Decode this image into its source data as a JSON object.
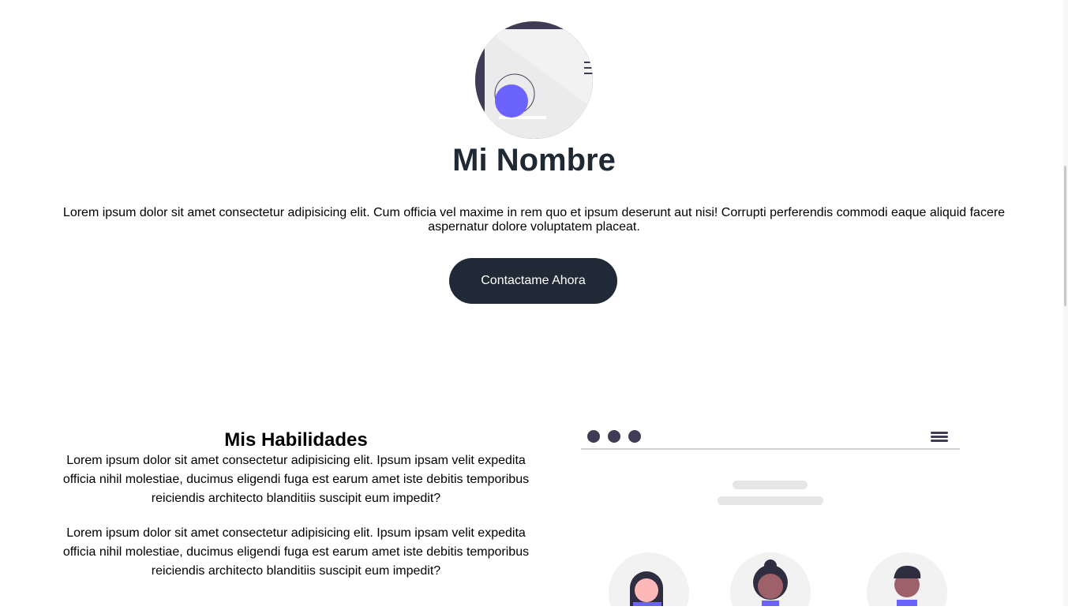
{
  "hero": {
    "name": "Mi Nombre",
    "description": "Lorem ipsum dolor sit amet consectetur adipisicing elit. Cum officia vel maxime in rem quo et ipsum deserunt aut nisi! Corrupti perferendis commodi eaque aliquid facere aspernatur dolore voluptatem placeat.",
    "cta_label": "Contactame Ahora",
    "avatar_icon": "developer-illustration-icon"
  },
  "skills": {
    "title": "Mis Habilidades",
    "paragraphs": [
      "Lorem ipsum dolor sit amet consectetur adipisicing elit. Ipsum ipsam velit expedita officia nihil molestiae, ducimus eligendi fuga est earum amet iste debitis temporibus reiciendis architecto blanditiis suscipit eum impedit?",
      "Lorem ipsum dolor sit amet consectetur adipisicing elit. Ipsum ipsam velit expedita officia nihil molestiae, ducimus eligendi fuga est earum amet iste debitis temporibus reiciendis architecto blanditiis suscipit eum impedit?"
    ],
    "illustration_icon": "team-profiles-illustration-icon"
  },
  "colors": {
    "primary_dark": "#1f2a36",
    "accent": "#6c63ff",
    "illustration_dark": "#3f3d56",
    "illustration_light": "#e6e6e6"
  }
}
